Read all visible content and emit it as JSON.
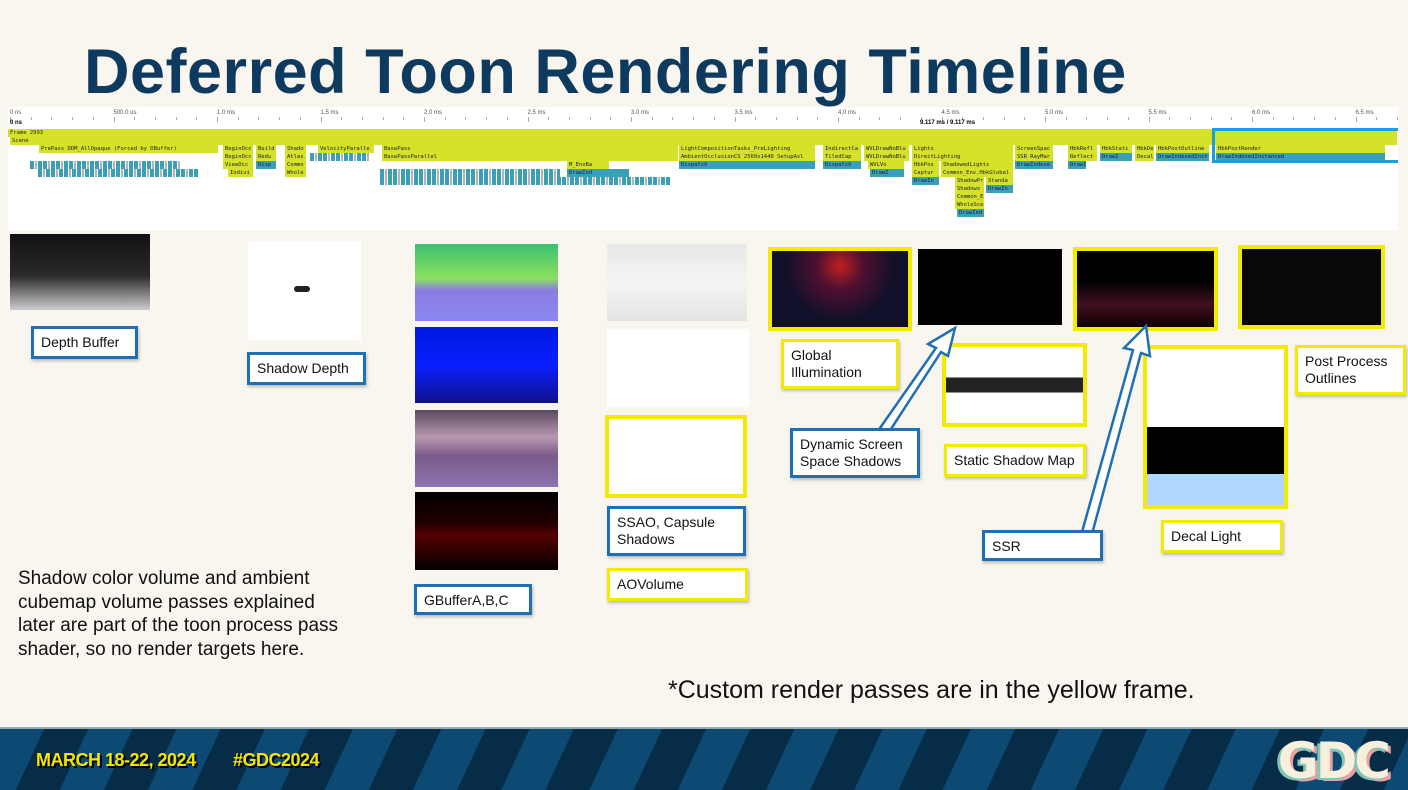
{
  "title": "Deferred Toon Rendering Timeline",
  "timeline": {
    "ticks": [
      "0 ns",
      "500.0 us",
      "1.0 ms",
      "1.5 ms",
      "2.0 ms",
      "2.5 ms",
      "3.0 ms",
      "3.5 ms",
      "4.0 ms",
      "4.5 ms",
      "5.0 ms",
      "5.5 ms",
      "6.0 ms",
      "6.5 ms"
    ],
    "cursor": "0 ns",
    "range": "9.117 ms / 9.117 ms",
    "bars": [
      {
        "label": "Frame 2993",
        "kind": "y"
      },
      {
        "label": "Scene",
        "kind": "y"
      },
      {
        "label": "PrePass DDM_AllOpaque (Forced by DBuffer)",
        "kind": "y"
      },
      {
        "label": "BeginOcc",
        "kind": "y"
      },
      {
        "label": "Build",
        "kind": "y"
      },
      {
        "label": "Shado",
        "kind": "y"
      },
      {
        "label": "VelocityParalle",
        "kind": "y"
      },
      {
        "label": "BasePass",
        "kind": "y"
      },
      {
        "label": "LightCompositionTasks_PreLighting",
        "kind": "y"
      },
      {
        "label": "IndirectCa",
        "kind": "y"
      },
      {
        "label": "WVLDrawNoBlu",
        "kind": "y"
      },
      {
        "label": "Lights",
        "kind": "y"
      },
      {
        "label": "ScreenSpac",
        "kind": "y"
      },
      {
        "label": "HbkRefl",
        "kind": "y"
      },
      {
        "label": "HbkStati",
        "kind": "y"
      },
      {
        "label": "HbkDe",
        "kind": "y"
      },
      {
        "label": "HbkPostOutline",
        "kind": "y"
      },
      {
        "label": "HbkPostRender",
        "kind": "y"
      },
      {
        "label": "BeginOcc",
        "kind": "y"
      },
      {
        "label": "Redu",
        "kind": "y"
      },
      {
        "label": "Atlas",
        "kind": "y"
      },
      {
        "label": "BasePassParallel",
        "kind": "y"
      },
      {
        "label": "AmbientOcclusionCS 2560x1440 SetupAsl",
        "kind": "y"
      },
      {
        "label": "TiledCap",
        "kind": "y"
      },
      {
        "label": "WVLDrawNoBlu",
        "kind": "y"
      },
      {
        "label": "DirectLighting",
        "kind": "y"
      },
      {
        "label": "SSR RayMar",
        "kind": "y"
      },
      {
        "label": "Reflect",
        "kind": "y"
      },
      {
        "label": "DrawI",
        "kind": "t"
      },
      {
        "label": "Decal",
        "kind": "y"
      },
      {
        "label": "DrawIndexedInst",
        "kind": "t"
      },
      {
        "label": "DrawIndexedInstanced",
        "kind": "t"
      },
      {
        "label": "ViewOcc",
        "kind": "y"
      },
      {
        "label": "Disp",
        "kind": "t"
      },
      {
        "label": "Commo",
        "kind": "y"
      },
      {
        "label": "M_EnvBa",
        "kind": "y"
      },
      {
        "label": "Dispatch",
        "kind": "t"
      },
      {
        "label": "Dispatch",
        "kind": "t"
      },
      {
        "label": "WVLVo",
        "kind": "y"
      },
      {
        "label": "HbkPos",
        "kind": "y"
      },
      {
        "label": "ShadowedLights",
        "kind": "y"
      },
      {
        "label": "DrawIndexe",
        "kind": "t"
      },
      {
        "label": "DrawI",
        "kind": "t"
      },
      {
        "label": "Indivi",
        "kind": "y"
      },
      {
        "label": "Whole",
        "kind": "y"
      },
      {
        "label": "DrawInd",
        "kind": "t"
      },
      {
        "label": "DrawI",
        "kind": "t"
      },
      {
        "label": "Captur",
        "kind": "y"
      },
      {
        "label": "Common_Env.HbkGlobal",
        "kind": "y"
      },
      {
        "label": "DrawIn",
        "kind": "t"
      },
      {
        "label": "ShadowPr",
        "kind": "y"
      },
      {
        "label": "Standa",
        "kind": "y"
      },
      {
        "label": "Shadows",
        "kind": "y"
      },
      {
        "label": "DrawIn",
        "kind": "t"
      },
      {
        "label": "Common_E",
        "kind": "y"
      },
      {
        "label": "WholeSce",
        "kind": "y"
      },
      {
        "label": "DrawInd",
        "kind": "t"
      }
    ],
    "highlight_color": "#1aa0e0"
  },
  "labels": {
    "depth": "Depth Buffer",
    "shadow_depth": "Shadow Depth",
    "gbuffer": "GBufferA,B,C",
    "ssao": "SSAO, Capsule Shadows",
    "aovolume": "AOVolume",
    "gi": "Global Illumination",
    "dsss": "Dynamic Screen Space Shadows",
    "static": "Static Shadow Map",
    "ssr": "SSR",
    "decal": "Decal Light",
    "post": "Post Process Outlines"
  },
  "note": "Shadow color volume and ambient cubemap volume passes explained later are part of the toon process pass shader, so no render targets here.",
  "footnote": "*Custom render passes are in the yellow frame.",
  "banner": {
    "dates": "MARCH 18-22, 2024",
    "hashtag": "#GDC2024",
    "logo": "GDC"
  },
  "colors": {
    "title": "#0f3a5f",
    "custom_frame": "#f2ea00",
    "standard_frame": "#1f6fb5",
    "pass_bar": "#d6e22a",
    "draw_bar": "#3aa0b5"
  }
}
